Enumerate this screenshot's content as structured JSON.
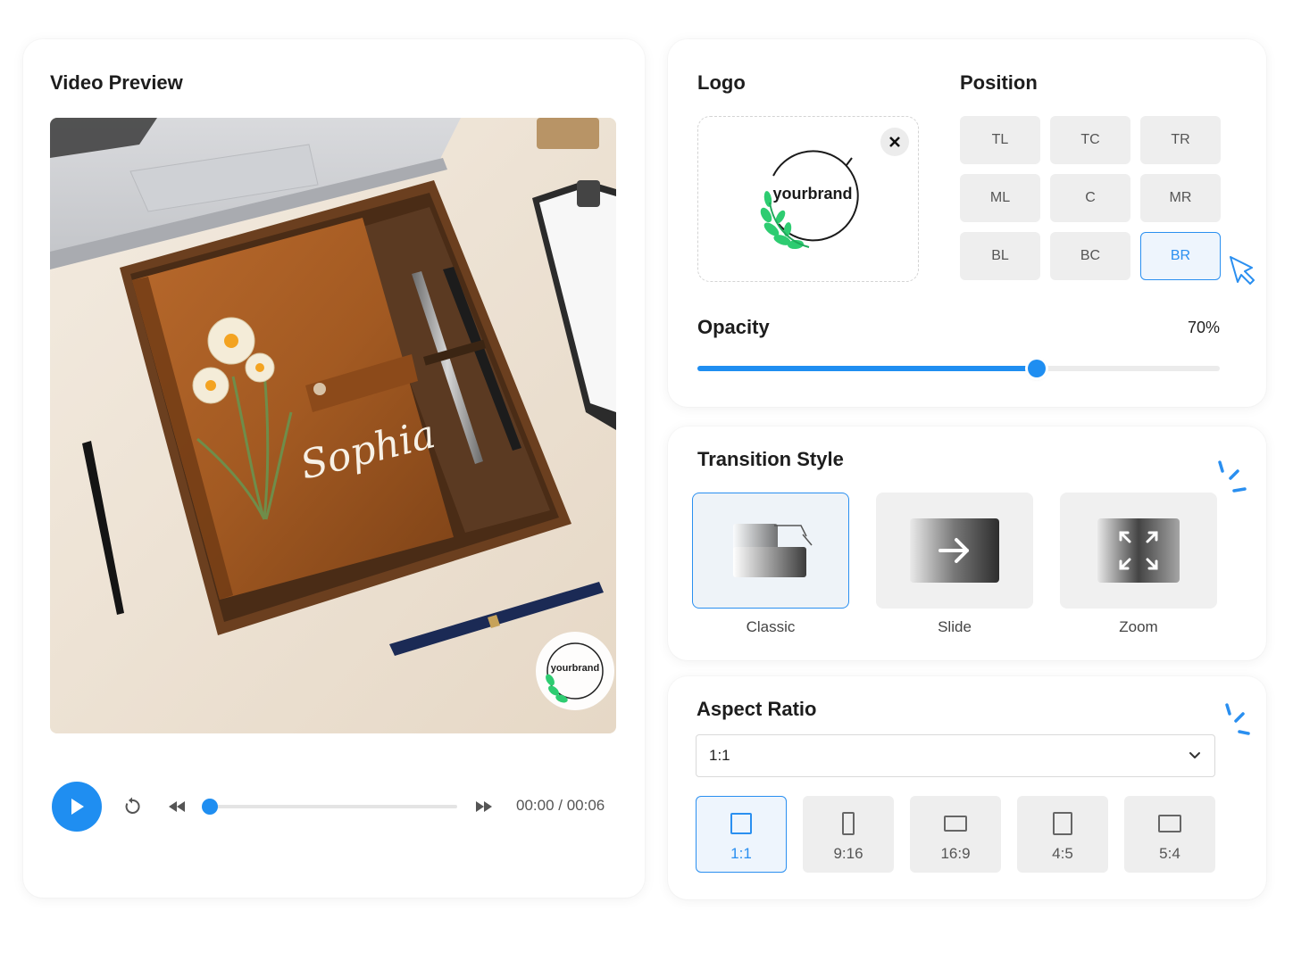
{
  "video_preview": {
    "title": "Video Preview",
    "image_text": "Sophia",
    "watermark_text": "yourbrand",
    "time": "00:00 / 00:06",
    "progress": 0.0
  },
  "logo": {
    "title": "Logo",
    "brand_text": "yourbrand",
    "position_title": "Position",
    "positions": [
      "TL",
      "TC",
      "TR",
      "ML",
      "C",
      "MR",
      "BL",
      "BC",
      "BR"
    ],
    "selected_position": "BR",
    "opacity_label": "Opacity",
    "opacity_value": "70%",
    "opacity_fraction": 0.65
  },
  "transition": {
    "title": "Transition Style",
    "options": [
      "Classic",
      "Slide",
      "Zoom"
    ],
    "selected": "Classic"
  },
  "aspect": {
    "title": "Aspect Ratio",
    "selected_value": "1:1",
    "options": [
      "1:1",
      "9:16",
      "16:9",
      "4:5",
      "5:4"
    ]
  },
  "colors": {
    "accent": "#1f8ef1",
    "leaf_green": "#2ecc71"
  }
}
